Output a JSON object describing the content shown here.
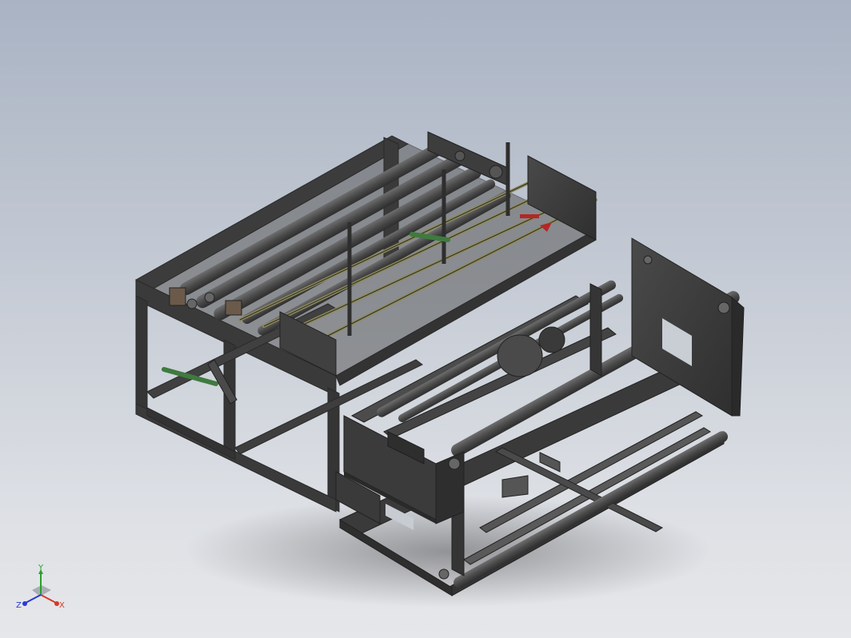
{
  "view": {
    "background_top": "#a9b3c3",
    "background_bottom": "#e6e7ea",
    "frame_color": "#3a3a3a",
    "roller_color": "#4a4a4a",
    "rod_color": "#8e8a5a",
    "accent_red": "#b52626",
    "accent_green": "#3f7a3f"
  },
  "axes": {
    "x_label": "X",
    "y_label": "Y",
    "z_label": "Z",
    "x_color": "#d43a2a",
    "y_color": "#2aa02a",
    "z_color": "#2a3ad4"
  }
}
